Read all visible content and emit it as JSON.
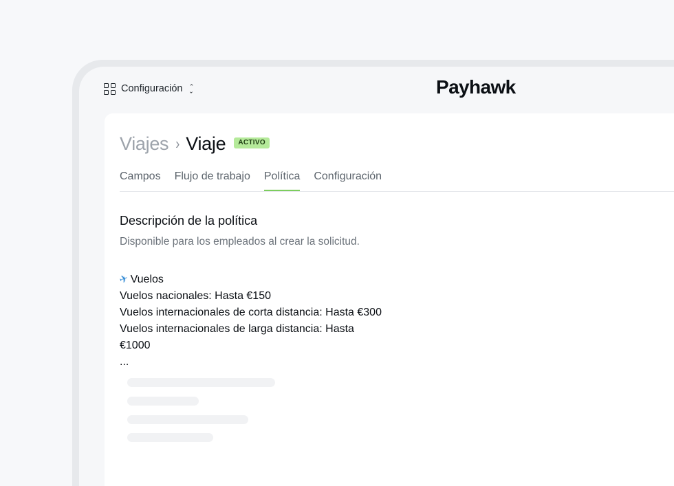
{
  "topbar": {
    "workspace_label": "Configuración",
    "logo_text": "Payhawk"
  },
  "breadcrumb": {
    "parent": "Viajes",
    "separator": "›",
    "current": "Viaje",
    "status": "ACTIVO"
  },
  "tabs": [
    {
      "label": "Campos",
      "active": false
    },
    {
      "label": "Flujo de trabajo",
      "active": false
    },
    {
      "label": "Política",
      "active": true
    },
    {
      "label": "Configuración",
      "active": false
    }
  ],
  "policy_section": {
    "title": "Descripción de la política",
    "subtitle": "Disponible para los empleados al crear la solicitud.",
    "heading": "Vuelos",
    "lines": [
      "Vuelos nacionales: Hasta €150",
      "Vuelos internacionales de corta distancia: Hasta €300",
      "Vuelos internacionales de larga distancia: Hasta",
      "€1000",
      "..."
    ]
  },
  "colors": {
    "accent": "#7dcd5e",
    "badge_bg": "#b5ea9a",
    "page_bg": "#f7f8fa"
  },
  "icons": {
    "workspace": "grid-icon",
    "switcher": "chevron-updown-icon",
    "heading": "airplane-icon"
  }
}
